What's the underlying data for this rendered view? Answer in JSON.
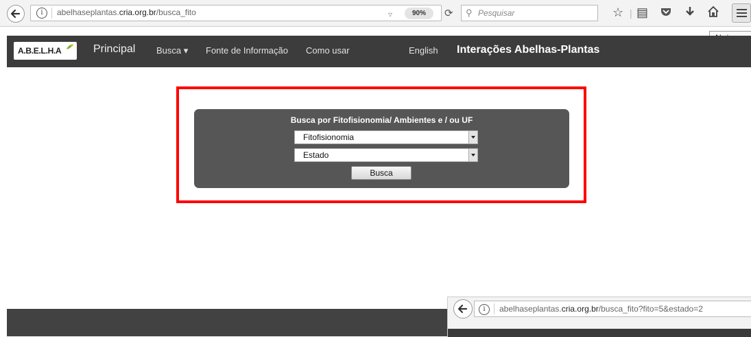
{
  "browser": {
    "url_prefix": "abelhaseplantas.",
    "url_domain": "cria.org.br",
    "url_path": "/busca_fito",
    "zoom": "90%",
    "search_placeholder": "Pesquisar",
    "tooltip": "Abrir menu"
  },
  "nav": {
    "logo_text": "A.B.E.L.H.A",
    "items": [
      "Principal",
      "Busca ▾",
      "Fonte de Informação",
      "Como usar",
      "English"
    ],
    "site_title": "Interações Abelhas-Plantas"
  },
  "search_form": {
    "title": "Busca por Fitofisionomia/ Ambientes e / ou UF",
    "select_fito": "Fitofisionomia",
    "select_estado": "Estado",
    "button_label": "Busca"
  },
  "overlay": {
    "url_prefix": "abelhaseplantas.",
    "url_domain": "cria.org.br",
    "url_path": "/busca_fito?fito=5&estado=2"
  },
  "colors": {
    "nav_bg": "#3c3c3c",
    "panel_bg": "#565656",
    "highlight": "#ff0000"
  }
}
